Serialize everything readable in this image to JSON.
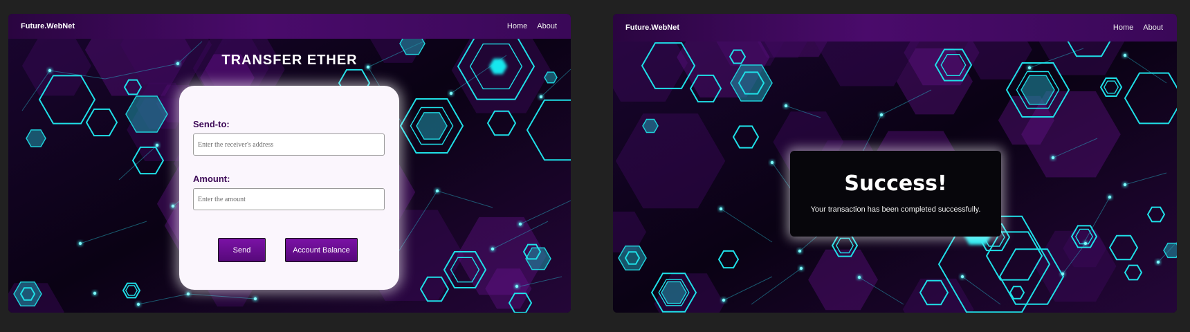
{
  "left_screen": {
    "navbar": {
      "brand": "Future.WebNet",
      "links": [
        "Home",
        "About"
      ]
    },
    "heading": "TRANSFER ETHER",
    "form": {
      "send_to_label": "Send-to:",
      "send_to_placeholder": "Enter the receiver's address",
      "amount_label": "Amount:",
      "amount_placeholder": "Enter the amount",
      "send_button": "Send",
      "balance_button": "Account Balance"
    }
  },
  "right_screen": {
    "navbar": {
      "brand": "Future.WebNet",
      "links": [
        "Home",
        "About"
      ]
    },
    "modal": {
      "title": "Success!",
      "message": "Your transaction has been completed successfully."
    }
  },
  "colors": {
    "page_background": "#212121",
    "accent_purple": "#6a0f91",
    "neon_cyan": "#19e8ee",
    "card_background": "#fbf6fd",
    "label_purple": "#3d0a57"
  },
  "icons": {
    "background_pattern": "neon-hexagon-network"
  }
}
